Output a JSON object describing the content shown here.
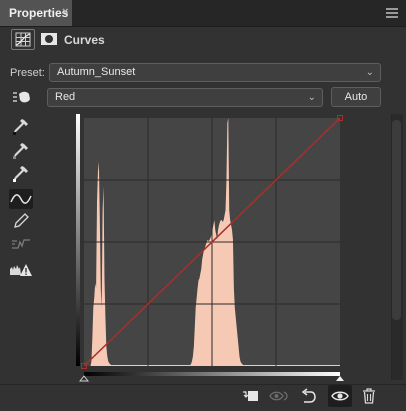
{
  "panel": {
    "tab_title": "Properties",
    "tab_close": "×"
  },
  "header": {
    "title": "Curves"
  },
  "preset": {
    "label": "Preset:",
    "value": "Autumn_Sunset"
  },
  "channel": {
    "value": "Red",
    "auto_label": "Auto"
  },
  "tools": [
    {
      "name": "on-image-adjust-icon",
      "selected": false
    },
    {
      "name": "black-point-eyedropper-icon",
      "selected": false
    },
    {
      "name": "gray-point-eyedropper-icon",
      "selected": false
    },
    {
      "name": "white-point-eyedropper-icon",
      "selected": false
    },
    {
      "name": "curve-points-icon",
      "selected": true
    },
    {
      "name": "pencil-draw-icon",
      "selected": false
    },
    {
      "name": "smooth-curve-icon",
      "selected": false
    },
    {
      "name": "clipping-warning-icon",
      "selected": false
    }
  ],
  "graph": {
    "background": "#454545",
    "histogram_color": "#f6c9b4",
    "curve_color": "#a8302a",
    "curve_points": [
      [
        0,
        0
      ],
      [
        255,
        255
      ]
    ],
    "grid_divisions": 4,
    "histogram": [
      0,
      0,
      0,
      0,
      0,
      0,
      0,
      0,
      5,
      30,
      60,
      70,
      85,
      80,
      170,
      200,
      210,
      150,
      80,
      60,
      160,
      185,
      90,
      50,
      20,
      10,
      5,
      3,
      2,
      1,
      1,
      1,
      1,
      1,
      1,
      1,
      1,
      1,
      1,
      1,
      1,
      1,
      1,
      1,
      1,
      1,
      1,
      1,
      1,
      1,
      1,
      1,
      1,
      1,
      1,
      1,
      1,
      1,
      1,
      1,
      1,
      1,
      1,
      1,
      1,
      1,
      1,
      1,
      1,
      1,
      1,
      1,
      1,
      1,
      1,
      1,
      1,
      1,
      1,
      1,
      1,
      1,
      1,
      1,
      1,
      1,
      1,
      1,
      1,
      1,
      1,
      1,
      1,
      1,
      1,
      1,
      1,
      1,
      1,
      1,
      1,
      1,
      1,
      1,
      1,
      1,
      1,
      1,
      1,
      1,
      1,
      1,
      1,
      1,
      1,
      2,
      5,
      10,
      20,
      40,
      60,
      70,
      80,
      88,
      90,
      95,
      100,
      110,
      115,
      120,
      122,
      125,
      128,
      130,
      128,
      130,
      132,
      135,
      140,
      145,
      150,
      140,
      135,
      130,
      140,
      145,
      148,
      150,
      150,
      148,
      150,
      155,
      160,
      190,
      250,
      255,
      160,
      150,
      145,
      140,
      130,
      80,
      60,
      50,
      40,
      30,
      20,
      10,
      5,
      3,
      2,
      1,
      1,
      1,
      1,
      1,
      1,
      1,
      1,
      1,
      1,
      1,
      1,
      1,
      1,
      1,
      1,
      1,
      1,
      1,
      1,
      1,
      1,
      1,
      1,
      1,
      1,
      1,
      1,
      1,
      1,
      1,
      1,
      1,
      1,
      1,
      1,
      1,
      1,
      1,
      1,
      1,
      1,
      1,
      1,
      1,
      1,
      1,
      1,
      1,
      1,
      1,
      1,
      1,
      1,
      1,
      1,
      1,
      1,
      1,
      1,
      1,
      1,
      1,
      1,
      1,
      1,
      1,
      1,
      1,
      1,
      1,
      1,
      1,
      1,
      1,
      1,
      1,
      1,
      1,
      1,
      1,
      1,
      1,
      1,
      1,
      1,
      1,
      1,
      1,
      1,
      1,
      1,
      1,
      1,
      1,
      1,
      1,
      1,
      1,
      1,
      1,
      1,
      1,
      1,
      1
    ]
  },
  "bottom_tools": [
    "clip-to-layer-icon",
    "view-previous-state-icon",
    "reset-adjustments-icon",
    "toggle-visibility-eye-icon",
    "delete-adjustment-trash-icon"
  ]
}
